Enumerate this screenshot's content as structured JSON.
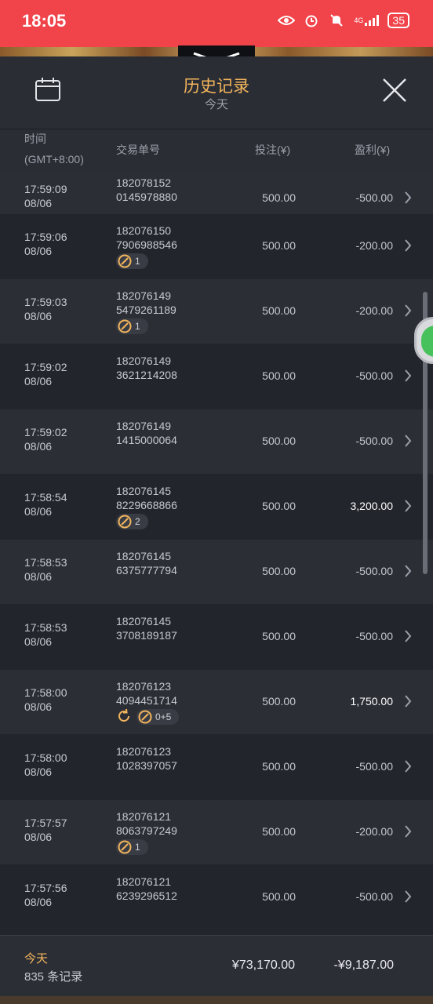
{
  "status": {
    "time": "18:05",
    "signal": "4G",
    "battery": "35"
  },
  "header": {
    "title": "历史记录",
    "subtitle": "今天"
  },
  "columns": {
    "time": "时间",
    "tz": "(GMT+8:00)",
    "order": "交易单号",
    "stake": "投注(¥)",
    "pnl": "盈利(¥)"
  },
  "rows": [
    {
      "time": "17:59:09",
      "date": "08/06",
      "order1": "182078152",
      "order2": "0145978880",
      "stake": "500.00",
      "pnl": "-500.00",
      "badge": ""
    },
    {
      "time": "17:59:06",
      "date": "08/06",
      "order1": "182076150",
      "order2": "7906988546",
      "stake": "500.00",
      "pnl": "-200.00",
      "badge": "1"
    },
    {
      "time": "17:59:03",
      "date": "08/06",
      "order1": "182076149",
      "order2": "5479261189",
      "stake": "500.00",
      "pnl": "-200.00",
      "badge": "1"
    },
    {
      "time": "17:59:02",
      "date": "08/06",
      "order1": "182076149",
      "order2": "3621214208",
      "stake": "500.00",
      "pnl": "-500.00",
      "badge": ""
    },
    {
      "time": "17:59:02",
      "date": "08/06",
      "order1": "182076149",
      "order2": "1415000064",
      "stake": "500.00",
      "pnl": "-500.00",
      "badge": ""
    },
    {
      "time": "17:58:54",
      "date": "08/06",
      "order1": "182076145",
      "order2": "8229668866",
      "stake": "500.00",
      "pnl": "3,200.00",
      "badge": "2"
    },
    {
      "time": "17:58:53",
      "date": "08/06",
      "order1": "182076145",
      "order2": "6375777794",
      "stake": "500.00",
      "pnl": "-500.00",
      "badge": ""
    },
    {
      "time": "17:58:53",
      "date": "08/06",
      "order1": "182076145",
      "order2": "3708189187",
      "stake": "500.00",
      "pnl": "-500.00",
      "badge": ""
    },
    {
      "time": "17:58:00",
      "date": "08/06",
      "order1": "182076123",
      "order2": "4094451714",
      "stake": "500.00",
      "pnl": "1,750.00",
      "badge": "0+5"
    },
    {
      "time": "17:58:00",
      "date": "08/06",
      "order1": "182076123",
      "order2": "1028397057",
      "stake": "500.00",
      "pnl": "-500.00",
      "badge": ""
    },
    {
      "time": "17:57:57",
      "date": "08/06",
      "order1": "182076121",
      "order2": "8063797249",
      "stake": "500.00",
      "pnl": "-200.00",
      "badge": "1"
    },
    {
      "time": "17:57:56",
      "date": "08/06",
      "order1": "182076121",
      "order2": "6239296512",
      "stake": "500.00",
      "pnl": "-500.00",
      "badge": ""
    }
  ],
  "footer": {
    "today": "今天",
    "count": "835 条记录",
    "total_stake": "¥73,170.00",
    "total_pnl": "-¥9,187.00"
  }
}
